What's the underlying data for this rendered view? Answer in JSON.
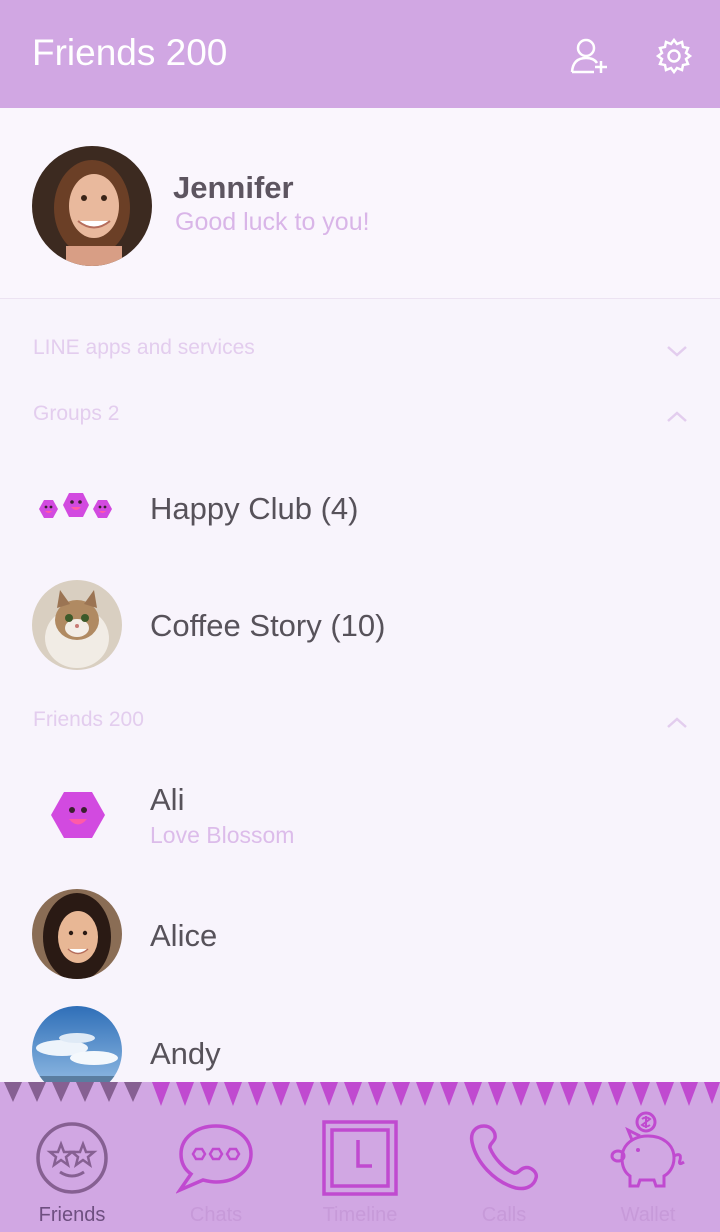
{
  "header": {
    "title": "Friends 200",
    "add_friend_icon": "add-person-icon",
    "settings_icon": "gear-icon"
  },
  "profile": {
    "name": "Jennifer",
    "status": "Good luck to you!"
  },
  "sections": [
    {
      "label": "LINE apps and services",
      "state": "collapsed"
    },
    {
      "label": "Groups 2",
      "state": "expanded"
    },
    {
      "label": "Friends 200",
      "state": "expanded"
    }
  ],
  "groups": [
    {
      "name": "Happy Club (4)"
    },
    {
      "name": "Coffee Story (10)"
    }
  ],
  "friends": [
    {
      "name": "Ali",
      "status": "Love Blossom"
    },
    {
      "name": "Alice"
    },
    {
      "name": "Andy"
    }
  ],
  "tabs": [
    {
      "label": "Friends",
      "active": true
    },
    {
      "label": "Chats"
    },
    {
      "label": "Timeline"
    },
    {
      "label": "Calls"
    },
    {
      "label": "Wallet"
    }
  ],
  "colors": {
    "header": "#d1a7e3",
    "accent": "#c04ad0",
    "background": "#f8f4fc"
  }
}
